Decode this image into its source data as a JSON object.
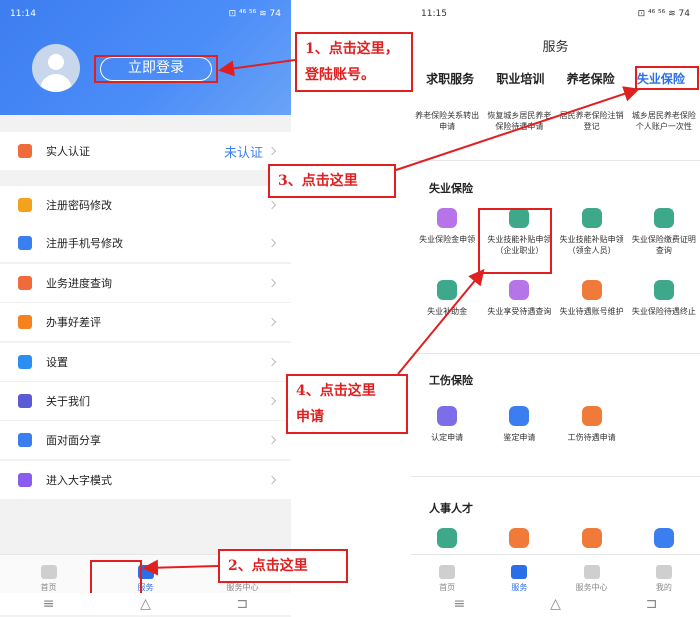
{
  "left": {
    "status_time": "11:14",
    "status_right": "⊡ ⁴⁶ ⁵⁶ ≋ 74",
    "login_label": "立即登录",
    "menu": [
      {
        "label": "实人认证",
        "status": "未认证",
        "color": "#f06a3a"
      },
      {
        "label": "注册密码修改",
        "color": "#f4a11c"
      },
      {
        "label": "注册手机号修改",
        "color": "#3a7ef0"
      },
      {
        "label": "业务进度查询",
        "color": "#f06a3a"
      },
      {
        "label": "办事好差评",
        "color": "#f5821e"
      },
      {
        "label": "设置",
        "color": "#2a8ff0"
      },
      {
        "label": "关于我们",
        "color": "#5b5bd6"
      },
      {
        "label": "面对面分享",
        "color": "#3a7ef0"
      },
      {
        "label": "进入大字模式",
        "color": "#8a5cf0"
      }
    ],
    "tabs": [
      "首页",
      "服务",
      "服务中心"
    ]
  },
  "right": {
    "status_time": "11:15",
    "status_right": "⊡ ⁴⁶ ⁵⁶ ≋ 74",
    "title": "服务",
    "toptabs": [
      "求职服务",
      "职业培训",
      "养老保险",
      "失业保险"
    ],
    "top_services": [
      "养老保险关系转出申请",
      "恢复城乡居民养老保险待遇申请",
      "居民养老保险注销登记",
      "城乡居民养老保险个人账户一次性"
    ],
    "section1": "失业保险",
    "unemp_row1": [
      "失业保险金申领",
      "失业技能补贴申领（企业职业）",
      "失业技能补贴申领（领金人员）",
      "失业保险缴费证明查询"
    ],
    "unemp_row2": [
      "失业补助金",
      "失业享受待遇查询",
      "失业待遇账号维护",
      "失业保险待遇终止"
    ],
    "section2": "工伤保险",
    "injury_row": [
      "认定申请",
      "鉴定申请",
      "工伤待遇申请"
    ],
    "section3": "人事人才",
    "tabs": [
      "首页",
      "服务",
      "服务中心",
      "我的"
    ]
  },
  "nav_symbols": [
    "≡",
    "△",
    "⊐"
  ],
  "annotations": {
    "note1": "1、点击这里，\n登陆账号。",
    "note2": "2、点击这里",
    "note3": "3、点击这里",
    "note4": "4、点击这里\n申请",
    "color": "#e02020"
  }
}
